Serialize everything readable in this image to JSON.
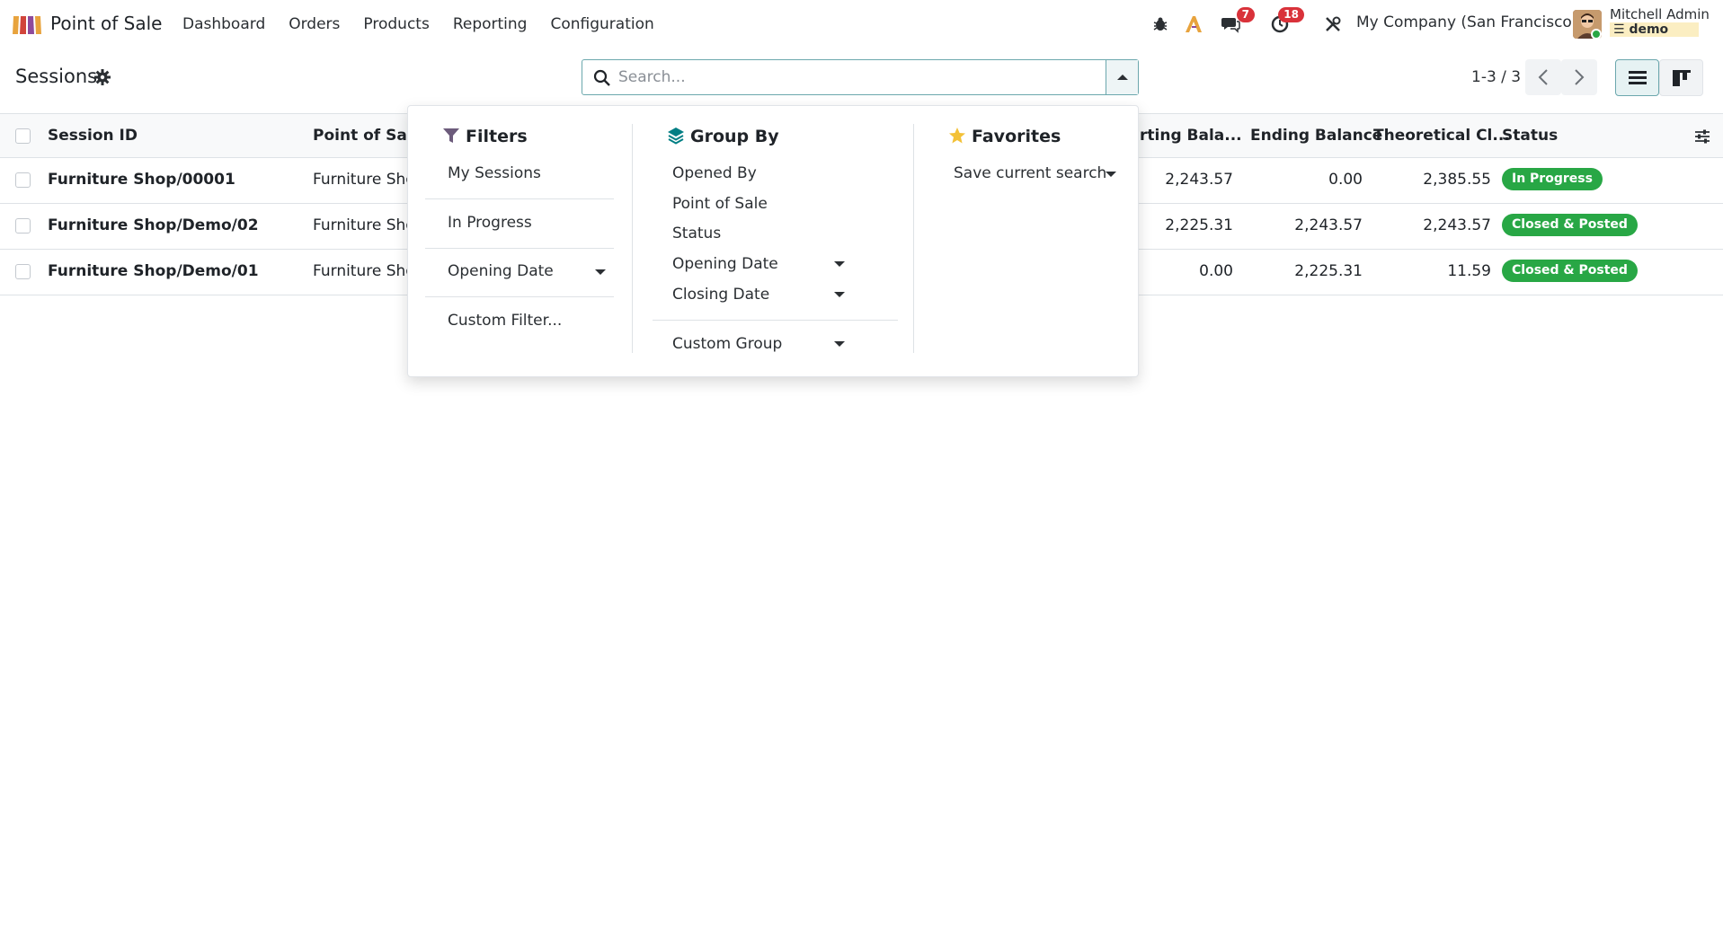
{
  "navbar": {
    "app_name": "Point of Sale",
    "menu": [
      "Dashboard",
      "Orders",
      "Products",
      "Reporting",
      "Configuration"
    ],
    "messages_badge": "7",
    "activities_badge": "18",
    "company": "My Company (San Francisco)",
    "user_name": "Mitchell Admin",
    "database": "demo"
  },
  "control_panel": {
    "title": "Sessions",
    "search_placeholder": "Search...",
    "pager": "1-3 / 3"
  },
  "table": {
    "headers": {
      "session_id": "Session ID",
      "point_of_sale": "Point of Sale",
      "starting_balance": "rting Bala...",
      "ending_balance": "Ending Balance",
      "theoretical": "Theoretical Cl...",
      "status": "Status"
    },
    "rows": [
      {
        "session_id": "Furniture Shop/00001",
        "point_of_sale": "Furniture Sho",
        "starting_balance": "2,243.57",
        "ending_balance": "0.00",
        "theoretical": "2,385.55",
        "status": "In Progress"
      },
      {
        "session_id": "Furniture Shop/Demo/02",
        "point_of_sale": "Furniture Sho",
        "starting_balance": "2,225.31",
        "ending_balance": "2,243.57",
        "theoretical": "2,243.57",
        "status": "Closed & Posted"
      },
      {
        "session_id": "Furniture Shop/Demo/01",
        "point_of_sale": "Furniture Sho",
        "starting_balance": "0.00",
        "ending_balance": "2,225.31",
        "theoretical": "11.59",
        "status": "Closed & Posted"
      }
    ]
  },
  "dropdown": {
    "filters": {
      "title": "Filters",
      "items": [
        "My Sessions",
        "In Progress",
        "Opening Date",
        "Custom Filter..."
      ]
    },
    "group_by": {
      "title": "Group By",
      "items": [
        "Opened By",
        "Point of Sale",
        "Status",
        "Opening Date",
        "Closing Date",
        "Custom Group"
      ]
    },
    "favorites": {
      "title": "Favorites",
      "items": [
        "Save current search"
      ]
    }
  },
  "colors": {
    "accent": "#6ba7ad",
    "status_green": "#28a745",
    "badge_red": "#d9323a"
  }
}
